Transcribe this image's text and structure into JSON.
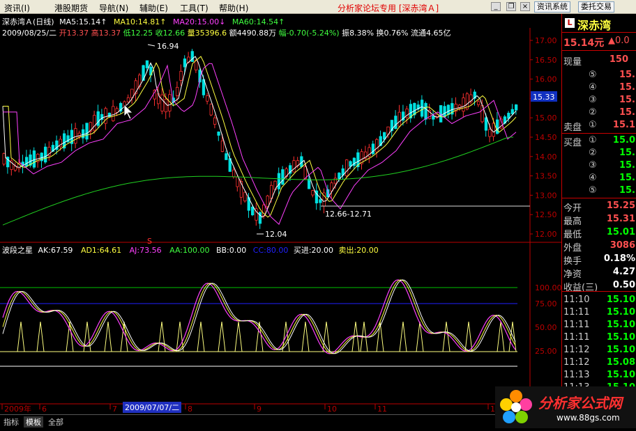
{
  "menu": {
    "items": [
      "资讯(I)",
      "港股期货",
      "导航(N)",
      "辅助(E)",
      "工具(T)",
      "帮助(H)"
    ],
    "app_title": "分析家论坛专用 [深赤湾Ａ]",
    "right_buttons": [
      "资讯系统",
      "委托交易"
    ]
  },
  "chart": {
    "symbol_line": "深赤湾Ａ(日线)",
    "ma5": "MA5:15.14↑",
    "ma10": "MA10:14.81↑",
    "ma20": "MA20:15.00↓",
    "ma60": "MA60:14.54↑",
    "date": "2009/08/25/二",
    "open": "开13.37",
    "high": "高13.37",
    "low": "低12.25",
    "close": "收12.66",
    "vol": "量35396.6",
    "amt": "额4490.88万",
    "change": "幅-0.70(-5.24%)",
    "amp": "振8.38%",
    "turn": "换0.76%",
    "float": "流通4.65亿",
    "price_ticks": [
      "17.00",
      "16.50",
      "16.00",
      "15.50",
      "15.00",
      "14.50",
      "14.00",
      "13.50",
      "13.00",
      "12.50",
      "12.00"
    ],
    "current_price": "15.33",
    "annotations": {
      "high": "16.94",
      "low": "12.04",
      "range": "12.66-12.71"
    },
    "ind_line": {
      "name": "波段之星",
      "ak": "AK:67.59",
      "ad1": "AD1:64.61",
      "aj": "AJ:73.56",
      "aa": "AA:100.00",
      "bb": "BB:0.00",
      "cc": "CC:80.00",
      "buy": "买进:20.00",
      "sell": "卖出:20.00"
    },
    "ind_ticks": [
      "100.00",
      "75.00",
      "50.00",
      "25.00"
    ],
    "months": [
      "2009年",
      "6",
      "7",
      "8",
      "9",
      "10",
      "11",
      "12"
    ],
    "cursor_date": "2009/07/07/二",
    "s_marker": "S"
  },
  "quote": {
    "name": "深赤湾",
    "logo_letter": "L",
    "price": "15.14元",
    "price_change": "▲0.0",
    "volume_label": "现量",
    "volume_value": "150",
    "sell_label": "卖盘",
    "buy_label": "买盘",
    "sell": [
      {
        "lvl": "⑤",
        "p": "15."
      },
      {
        "lvl": "④",
        "p": "15."
      },
      {
        "lvl": "③",
        "p": "15."
      },
      {
        "lvl": "②",
        "p": "15."
      },
      {
        "lvl": "①",
        "p": "15.1"
      }
    ],
    "buy": [
      {
        "lvl": "①",
        "p": "15.0"
      },
      {
        "lvl": "②",
        "p": "15."
      },
      {
        "lvl": "③",
        "p": "15."
      },
      {
        "lvl": "④",
        "p": "15."
      },
      {
        "lvl": "⑤",
        "p": "15."
      }
    ],
    "stats": [
      {
        "l": "今开",
        "v": "15.25",
        "c": "#ff5050"
      },
      {
        "l": "最高",
        "v": "15.31",
        "c": "#ff5050"
      },
      {
        "l": "最低",
        "v": "15.01",
        "c": "#00ff00"
      },
      {
        "l": "外盘",
        "v": "3086",
        "c": "#ff5050"
      },
      {
        "l": "换手",
        "v": "0.18%",
        "c": "#ffffff"
      },
      {
        "l": "净资",
        "v": "4.27",
        "c": "#ffffff"
      },
      {
        "l": "收益(三)",
        "v": "0.50",
        "c": "#ffffff"
      }
    ],
    "ticks": [
      [
        "11:10",
        "15.10"
      ],
      [
        "11:11",
        "15.10"
      ],
      [
        "11:11",
        "15.10"
      ],
      [
        "11:11",
        "15.10"
      ],
      [
        "11:12",
        "15.10"
      ],
      [
        "11:12",
        "15.08"
      ],
      [
        "11:13",
        "15.10"
      ],
      [
        "11:13",
        "15.10"
      ]
    ]
  },
  "status": {
    "tabs": [
      "指标",
      "模板",
      "全部"
    ]
  },
  "watermark": {
    "site": "分析家公式网",
    "url": "www.88gs.com"
  }
}
